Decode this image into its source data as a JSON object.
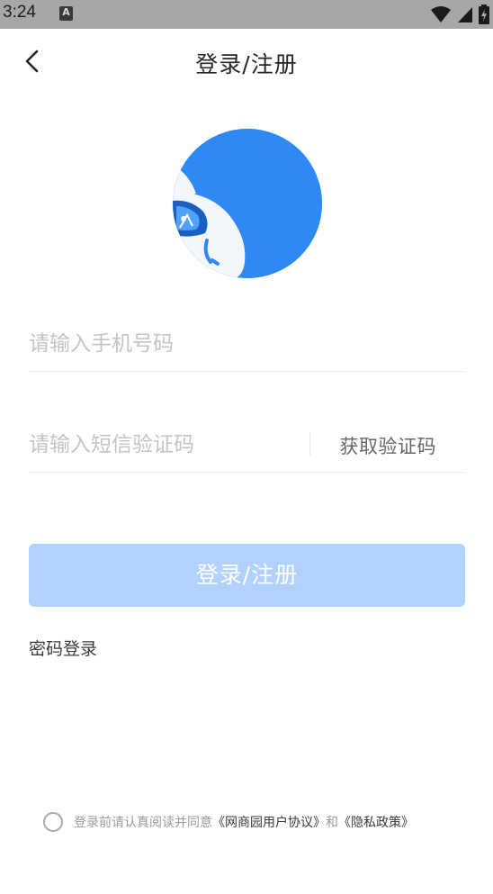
{
  "status_bar": {
    "time": "3:24",
    "notification_badge": "A"
  },
  "header": {
    "title": "登录/注册"
  },
  "form": {
    "phone_placeholder": "请输入手机号码",
    "code_placeholder": "请输入短信验证码",
    "get_code_label": "获取验证码",
    "submit_label": "登录/注册",
    "password_login_label": "密码登录"
  },
  "agreement": {
    "prefix": "登录前请认真阅读并同意",
    "user_agreement": "《网商园用户协议》",
    "and": "和",
    "privacy_policy": "《隐私政策》"
  },
  "colors": {
    "status_bar_bg": "#a7a7a7",
    "logo_blue": "#2f89f5",
    "submit_disabled": "#b1d2fd"
  },
  "icons": {
    "back": "chevron-left-icon",
    "wifi": "wifi-icon",
    "signal": "signal-icon",
    "battery": "battery-charging-icon"
  }
}
